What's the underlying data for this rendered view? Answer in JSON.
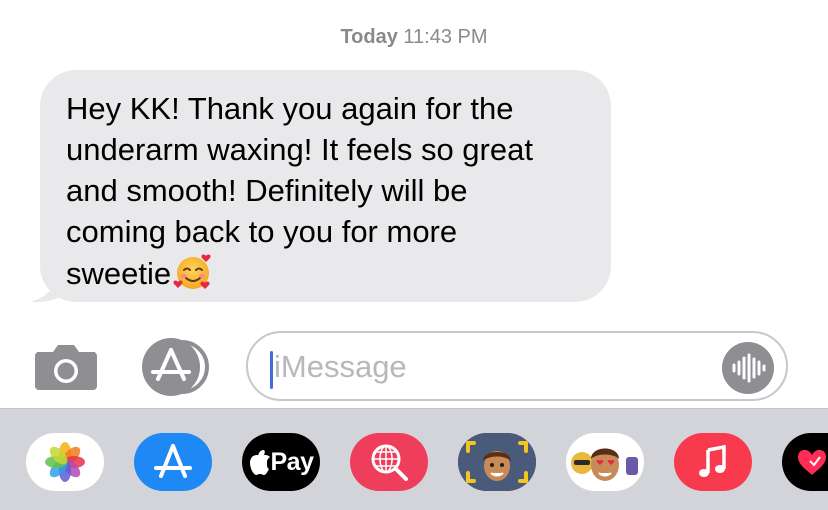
{
  "thread": {
    "timestamp_day": "Today",
    "timestamp_time": "11:43 PM"
  },
  "message": {
    "text": "Hey KK! Thank you again for the\nunderarm waxing! It feels so great\nand smooth! Definitely will be\ncoming back to you for more\nsweetie",
    "emoji_icon": "smiling-face-with-hearts-icon",
    "bubble_color": "#e9e9eb"
  },
  "composer": {
    "placeholder": "iMessage",
    "camera_icon": "camera-icon",
    "apps_icon": "app-store-icon",
    "audio_icon": "audio-waveform-icon",
    "caret_color": "#3f6de0"
  },
  "app_drawer": {
    "items": [
      {
        "name": "Photos",
        "icon": "photos-icon"
      },
      {
        "name": "App Store",
        "icon": "app-store-icon",
        "color": "#1e88f5"
      },
      {
        "name": "Apple Pay",
        "label": "Pay",
        "icon": "apple-pay-icon"
      },
      {
        "name": "Images search",
        "icon": "globe-search-icon",
        "color": "#ef3e5c"
      },
      {
        "name": "Memoji camera",
        "icon": "memoji-camera-icon"
      },
      {
        "name": "Memoji stickers",
        "icon": "memoji-stickers-icon"
      },
      {
        "name": "Music",
        "icon": "music-note-icon",
        "color": "#f83a4f"
      },
      {
        "name": "Digital Touch",
        "icon": "digital-touch-icon"
      }
    ]
  }
}
